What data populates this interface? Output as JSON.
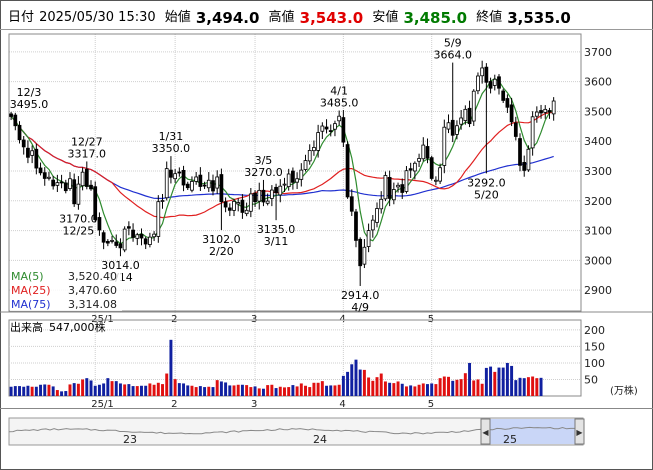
{
  "header": {
    "date_label": "日付",
    "date": "2025/05/30 15:30",
    "open_label": "始値",
    "open": "3,494.0",
    "high_label": "高値",
    "high": "3,543.0",
    "low_label": "安値",
    "low": "3,485.0",
    "close_label": "終値",
    "close": "3,535.0",
    "colors": {
      "high": "#e00000",
      "low": "#007a00",
      "neutral": "#000000"
    }
  },
  "chart_data": [
    {
      "type": "candlestick",
      "title": "",
      "ylim": [
        2830,
        3760
      ],
      "y_ticks": [
        "3700",
        "3600",
        "3500",
        "3400",
        "3300",
        "3200",
        "3100",
        "3000",
        "2900"
      ],
      "y_tick_values": [
        3700,
        3600,
        3500,
        3400,
        3300,
        3200,
        3100,
        3000,
        2900
      ],
      "x_month_labels": [
        {
          "label": "25/1",
          "index": 20
        },
        {
          "label": "2",
          "index": 39
        },
        {
          "label": "3",
          "index": 58
        },
        {
          "label": "4",
          "index": 79
        },
        {
          "label": "5",
          "index": 100
        }
      ],
      "closes": [
        3483,
        3452,
        3405,
        3381,
        3346,
        3368,
        3310,
        3294,
        3275,
        3279,
        3250,
        3261,
        3262,
        3234,
        3274,
        3190,
        3256,
        3296,
        3248,
        3240,
        3137,
        3102,
        3061,
        3058,
        3067,
        3050,
        3042,
        3105,
        3108,
        3077,
        3086,
        3075,
        3055,
        3078,
        3088,
        3197,
        3201,
        3308,
        3279,
        3291,
        3295,
        3253,
        3244,
        3265,
        3280,
        3248,
        3252,
        3269,
        3233,
        3280,
        3197,
        3179,
        3168,
        3198,
        3194,
        3161,
        3168,
        3223,
        3197,
        3235,
        3196,
        3199,
        3236,
        3227,
        3249,
        3256,
        3290,
        3262,
        3274,
        3303,
        3335,
        3369,
        3379,
        3429,
        3451,
        3441,
        3434,
        3459,
        3484,
        3397,
        3213,
        3165,
        3067,
        2982,
        3044,
        3100,
        3135,
        3174,
        3205,
        3285,
        3208,
        3238,
        3252,
        3228,
        3301,
        3303,
        3326,
        3342,
        3387,
        3343,
        3275,
        3269,
        3311,
        3447,
        3462,
        3420,
        3452,
        3478,
        3507,
        3459,
        3568,
        3619,
        3646,
        3598,
        3578,
        3608,
        3578,
        3537,
        3514,
        3465,
        3416,
        3319,
        3302,
        3373,
        3482,
        3498,
        3495,
        3507,
        3498,
        3535
      ],
      "annotations": [
        {
          "text": "12/3",
          "sub": "3495.0",
          "index": 0,
          "value": 3495,
          "place": "above"
        },
        {
          "text": "12/27",
          "sub": "3317.0",
          "index": 18,
          "value": 3317,
          "place": "above"
        },
        {
          "text": "3170.0",
          "sub": "12/25",
          "index": 16,
          "value": 3170,
          "place": "below"
        },
        {
          "text": "3014.0",
          "sub": "1/14",
          "index": 26,
          "value": 3014,
          "place": "below"
        },
        {
          "text": "1/31",
          "sub": "3350.0",
          "index": 38,
          "value": 3350,
          "place": "above"
        },
        {
          "text": "3/5",
          "sub": "3270.0",
          "index": 60,
          "value": 3270,
          "place": "above"
        },
        {
          "text": "3102.0",
          "sub": "2/20",
          "index": 50,
          "value": 3102,
          "place": "below"
        },
        {
          "text": "3135.0",
          "sub": "3/11",
          "index": 63,
          "value": 3135,
          "place": "below"
        },
        {
          "text": "4/1",
          "sub": "3485.0",
          "index": 78,
          "value": 3485,
          "place": "above"
        },
        {
          "text": "2914.0",
          "sub": "4/9",
          "index": 83,
          "value": 2914,
          "place": "below"
        },
        {
          "text": "5/9",
          "sub": "3664.0",
          "index": 105,
          "value": 3664,
          "place": "above"
        },
        {
          "text": "3292.0",
          "sub": "5/20",
          "index": 113,
          "value": 3292,
          "place": "below"
        }
      ],
      "series": [
        {
          "name": "MA(5)",
          "value": "3,520.40",
          "color": "#2e8b2e"
        },
        {
          "name": "MA(25)",
          "value": "3,470.60",
          "color": "#e02020"
        },
        {
          "name": "MA(75)",
          "value": "3,314.08",
          "color": "#2030d0"
        }
      ],
      "colors": {
        "up": "#ffffff",
        "down": "#000000",
        "outline": "#000000",
        "grid": "#c8c8c8"
      }
    },
    {
      "type": "bar",
      "title": "出来高",
      "latest_volume": "547,000株",
      "unit": "(万株)",
      "ylim": [
        0,
        230
      ],
      "y_ticks": [
        "200",
        "150",
        "100",
        "50"
      ],
      "y_tick_values": [
        200,
        150,
        100,
        50
      ],
      "x_month_labels": [
        {
          "label": "25/1",
          "index": 20
        },
        {
          "label": "2",
          "index": 39
        },
        {
          "label": "3",
          "index": 58
        },
        {
          "label": "4",
          "index": 79
        },
        {
          "label": "5",
          "index": 100
        }
      ],
      "values": [
        28,
        30,
        30,
        28,
        31,
        28,
        28,
        34,
        35,
        34,
        29,
        18,
        14,
        15,
        35,
        39,
        37,
        50,
        54,
        47,
        31,
        34,
        38,
        54,
        45,
        45,
        38,
        35,
        36,
        30,
        30,
        31,
        31,
        38,
        34,
        40,
        36,
        68,
        170,
        51,
        39,
        38,
        32,
        31,
        27,
        30,
        27,
        28,
        27,
        48,
        44,
        41,
        32,
        32,
        34,
        34,
        33,
        27,
        29,
        23,
        22,
        33,
        34,
        24,
        28,
        26,
        27,
        33,
        29,
        38,
        31,
        27,
        40,
        40,
        45,
        31,
        32,
        32,
        34,
        61,
        73,
        96,
        110,
        80,
        79,
        56,
        46,
        57,
        68,
        44,
        40,
        39,
        44,
        37,
        29,
        32,
        29,
        34,
        38,
        36,
        38,
        36,
        54,
        59,
        58,
        46,
        49,
        51,
        69,
        100,
        47,
        50,
        37,
        85,
        89,
        73,
        86,
        86,
        100,
        91,
        48,
        55,
        54,
        57,
        59,
        54,
        55
      ],
      "colors": {
        "up": "#e01010",
        "down": "#1020a0"
      }
    }
  ],
  "navigator": {
    "labels": [
      "23",
      "24",
      "25"
    ],
    "left_handle": "◀",
    "right_handle": "▶"
  }
}
